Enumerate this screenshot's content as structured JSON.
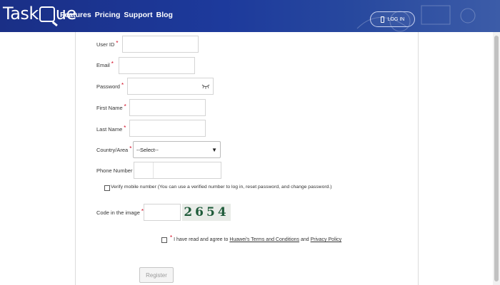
{
  "header": {
    "logo_text_1": "Task",
    "logo_text_2": "ue",
    "nav": [
      "Features",
      "Pricing",
      "Support",
      "Blog"
    ],
    "login_label": "LOG IN"
  },
  "form": {
    "user_id_label": "User ID",
    "email_label": "Email",
    "password_label": "Password",
    "first_name_label": "First Name",
    "last_name_label": "Last Name",
    "country_label": "Country/Area",
    "country_value": "--Select--",
    "phone_label": "Phone Number",
    "required_mark": "*",
    "verify_text": "Verify mobile number (You can use a verified number to log in, reset password, and change password.)",
    "code_label": "Code in the image",
    "captcha_text": "2654",
    "agree_prefix": "I have read and agree to",
    "terms_link": "Huawei's Terms and Conditions",
    "agree_and": "and",
    "privacy_link": "Privacy Policy",
    "register_label": "Register"
  },
  "colors": {
    "header_bg": "#1d3a9c",
    "required": "#d0021b"
  }
}
